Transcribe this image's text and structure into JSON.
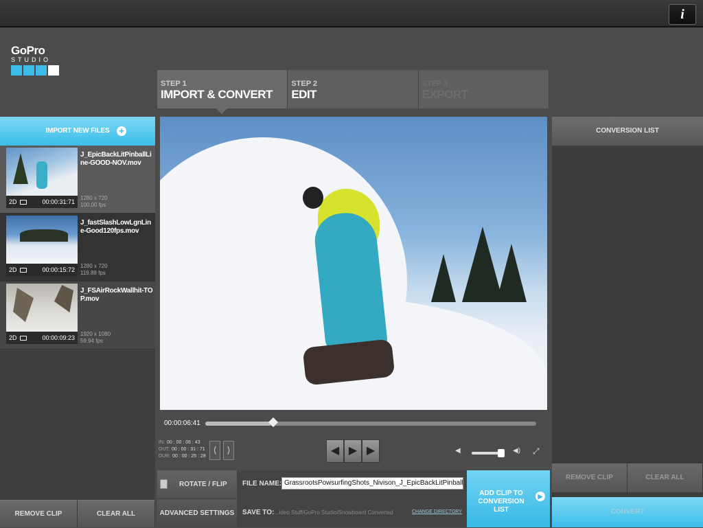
{
  "topbar": {
    "info_label": "i"
  },
  "logo": {
    "brand": "GoPro",
    "product": "STUDIO",
    "square_colors": [
      "#3cbde9",
      "#3cbde9",
      "#3cbde9",
      "#ffffff"
    ]
  },
  "steps": [
    {
      "num": "STEP 1",
      "name": "IMPORT & CONVERT",
      "state": "active"
    },
    {
      "num": "STEP 2",
      "name": "EDIT",
      "state": "normal"
    },
    {
      "num": "STEP 3",
      "name": "EXPORT",
      "state": "disabled"
    }
  ],
  "left_panel": {
    "import_label": "IMPORT NEW FILES",
    "clips": [
      {
        "name": "J_EpicBackLitPinballLine-GOOD-NOV.mov",
        "mode": "2D",
        "duration": "00:00:31:71",
        "resolution": "1280 x 720",
        "fps": "100.00 fps"
      },
      {
        "name": "J_fastSlashLowLgnLine-Good120fps.mov",
        "mode": "2D",
        "duration": "00:00:15:72",
        "resolution": "1280 x 720",
        "fps": "119.88 fps"
      },
      {
        "name": "J_FSAirRockWallhit-TOP.mov",
        "mode": "2D",
        "duration": "00:00:09:23",
        "resolution": "1920 x 1080",
        "fps": "59.94 fps"
      }
    ],
    "remove_clip": "REMOVE CLIP",
    "clear_all": "CLEAR ALL"
  },
  "player": {
    "timecode": "00:00:06:41",
    "progress": 0.2,
    "in_label": "IN:",
    "in_value": "00 : 00 : 06 : 43",
    "out_label": "OUT:",
    "out_value": "00 : 00 : 31 : 71",
    "dur_label": "DUR:",
    "dur_value": "00 : 00 : 25 : 28",
    "volume": 0.8
  },
  "bottom": {
    "rotate_flip": "ROTATE / FLIP",
    "advanced_settings": "ADVANCED SETTINGS",
    "file_name_label": "FILE NAME:",
    "file_name_value": "GrassrootsPowsurfingShots_Nivison_J_EpicBackLitPinballLine-",
    "save_to_label": "SAVE TO:",
    "save_to_value": "...ideo Stuff/GoPro Studio/Snowboard Converted",
    "change_directory": "CHANGE DIRECTORY",
    "add_clip_label": "ADD CLIP TO CONVERSION LIST"
  },
  "right_panel": {
    "header": "CONVERSION LIST",
    "remove_clip": "REMOVE CLIP",
    "clear_all": "CLEAR ALL",
    "convert": "CONVERT"
  }
}
